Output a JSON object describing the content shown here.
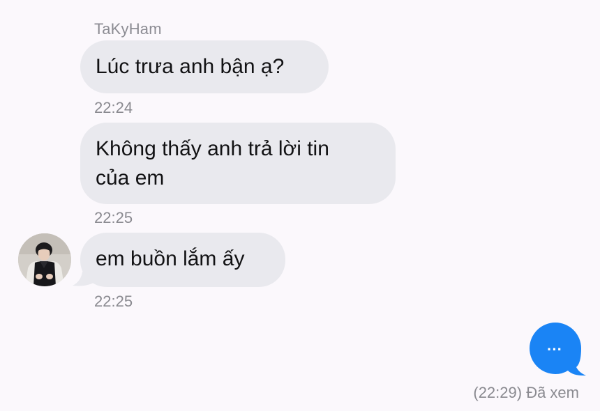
{
  "chat": {
    "sender_name": "TaKyHam",
    "messages": [
      {
        "text_lines": [
          "Lúc trưa anh bận ạ?"
        ],
        "time": "22:24"
      },
      {
        "text_lines": [
          "Không thấy anh trả lời tin",
          "của em"
        ],
        "time": "22:25"
      },
      {
        "text_lines": [
          "em buồn lắm ấy"
        ],
        "time": "22:25"
      }
    ],
    "typing_indicator": {
      "dots": "···"
    },
    "seen_status": "(22:29) Đã xem"
  },
  "colors": {
    "background": "#fbf8fc",
    "incoming_bubble": "#e9e9ee",
    "typing_bubble": "#1a84f5",
    "meta_text": "#8a8a90"
  },
  "icons": {
    "avatar": "contact-avatar",
    "typing": "typing-indicator-icon"
  }
}
